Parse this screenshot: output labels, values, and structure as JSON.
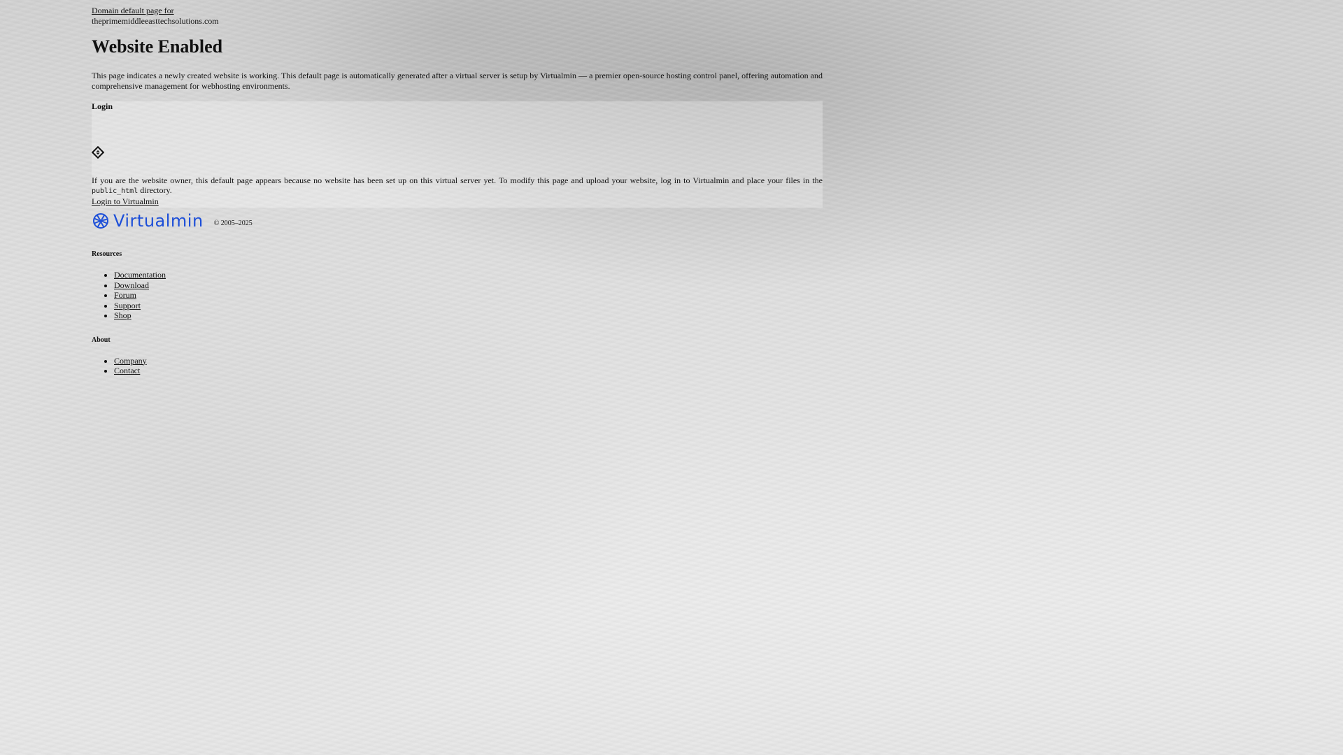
{
  "header": {
    "domain_label": "Domain default page for",
    "domain_name": "theprimemiddleeasttechsolutions.com"
  },
  "main": {
    "title": "Website Enabled",
    "intro": "This page indicates a newly created website is working. This default page is automatically generated after a virtual server is setup by Virtualmin — a premier open-source hosting control panel, offering automation and comprehensive management for webhosting environments."
  },
  "login": {
    "heading": "Login",
    "icon": "diamond-icon",
    "text_before": "If you are the website owner, this default page appears because no website has been set up on this virtual server yet. To modify this page and upload your website, log in to Virtualmin and place your files in the",
    "code": "public_html",
    "text_after": "directory.",
    "link_label": "Login to Virtualmin"
  },
  "brand": {
    "name": "Virtualmin",
    "color": "#1d4fd8",
    "copyright": "© 2005–2025"
  },
  "resources": {
    "heading": "Resources",
    "items": [
      "Documentation",
      "Download",
      "Forum",
      "Support",
      "Shop"
    ]
  },
  "about": {
    "heading": "About",
    "items": [
      "Company",
      "Contact"
    ]
  }
}
